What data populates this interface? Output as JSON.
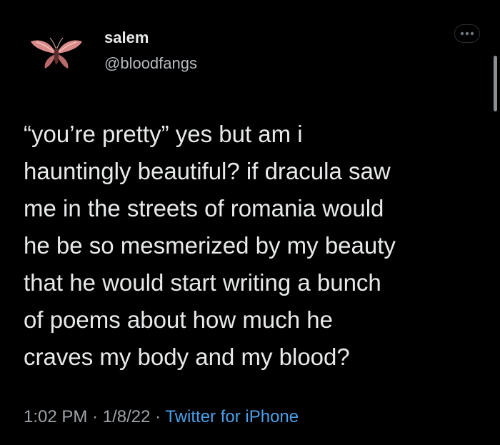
{
  "author": {
    "display_name": "salem",
    "handle": "@bloodfangs",
    "avatar_icon": "moth-avatar-icon"
  },
  "menu": {
    "icon": "more-options-icon"
  },
  "tweet": {
    "lines": [
      "“you’re pretty” yes but am i",
      "hauntingly beautiful? if dracula saw",
      "me in the streets of romania would",
      "he be so mesmerized by my beauty",
      "that he would start writing a bunch",
      "of poems about how much he",
      "craves my body and my blood?"
    ]
  },
  "meta": {
    "time": "1:02 PM",
    "separator": "·",
    "date": "1/8/22",
    "source": "Twitter for iPhone"
  },
  "colors": {
    "background": "#000000",
    "text": "#e7e9ea",
    "muted": "#9ea3a8",
    "link": "#4a9fe8"
  }
}
